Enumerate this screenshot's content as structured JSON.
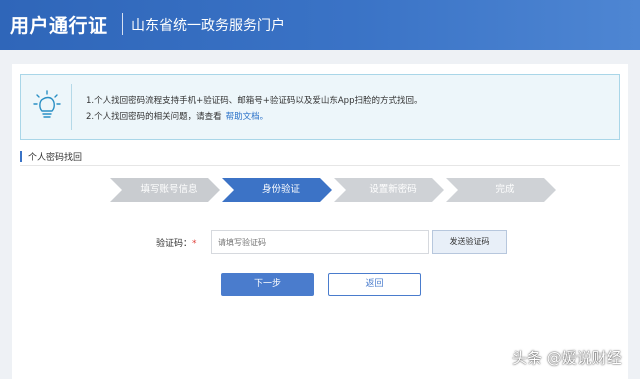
{
  "header": {
    "brand": "用户通行证",
    "portal": "山东省统一政务服务门户"
  },
  "notice": {
    "icon": "lightbulb-icon",
    "line1": "1.个人找回密码流程支持手机+验证码、邮箱号+验证码以及爱山东App扫脸的方式找回。",
    "line2_prefix": "2.个人找回密码的相关问题，请查看",
    "help_link": "帮助文档。"
  },
  "section": {
    "title": "个人密码找回"
  },
  "steps": [
    {
      "label": "填写账号信息",
      "state": "done"
    },
    {
      "label": "身份验证",
      "state": "active"
    },
    {
      "label": "设置新密码",
      "state": "todo"
    },
    {
      "label": "完成",
      "state": "todo"
    }
  ],
  "form": {
    "code_label": "验证码：",
    "required_mark": "*",
    "code_placeholder": "请填写验证码",
    "send_code_label": "发送验证码"
  },
  "actions": {
    "next_label": "下一步",
    "back_label": "返回"
  },
  "watermark": "头条 @媛说财经",
  "colors": {
    "header_blue": "#2f66b9",
    "accent_blue": "#3c73c6",
    "notice_bg": "#edf6fa",
    "step_inactive": "#c9ccd0",
    "required_red": "#e0403a"
  }
}
